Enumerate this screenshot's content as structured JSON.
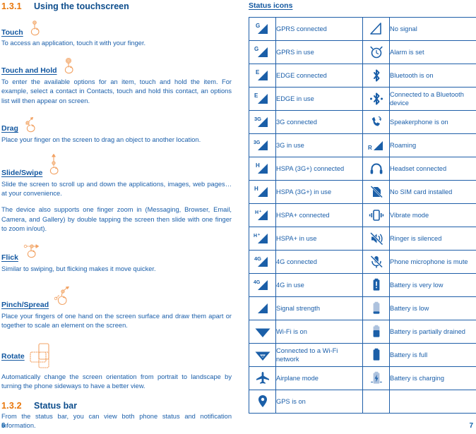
{
  "left_column": {
    "section": {
      "number": "1.3.1",
      "title": "Using the touchscreen"
    },
    "gestures": [
      {
        "name": "Touch",
        "icon": "hand-touch-icon",
        "paragraphs": [
          "To access an application, touch it with your finger."
        ]
      },
      {
        "name": "Touch and Hold",
        "icon": "hand-touch-hold-icon",
        "paragraphs": [
          "To enter the available options for an item, touch and hold the item. For example, select a contact in Contacts, touch and hold this contact, an options list will then appear on screen."
        ]
      },
      {
        "name": "Drag",
        "icon": "hand-drag-icon",
        "paragraphs": [
          "Place your finger on the screen to drag an object to another location."
        ]
      },
      {
        "name": "Slide/Swipe",
        "icon": "hand-slide-swipe-icon",
        "paragraphs": [
          "Slide the screen to scroll up and down the applications, images, web pages… at your convenience.",
          "The device also supports one finger zoom in (Messaging, Browser, Email, Camera, and Gallery) by double tapping the screen then slide with one finger to zoom in/out)."
        ]
      },
      {
        "name": "Flick",
        "icon": "hand-flick-icon",
        "paragraphs": [
          "Similar to swiping, but flicking makes it move quicker."
        ]
      },
      {
        "name": "Pinch/Spread",
        "icon": "hand-pinch-spread-icon",
        "paragraphs": [
          "Place your fingers of one hand on the screen surface and draw them apart or together to scale an element on the screen."
        ]
      },
      {
        "name": "Rotate",
        "icon": "rotate-device-icon",
        "paragraphs": [
          "Automatically change the screen orientation from portrait to landscape by turning the phone sideways to have a better view."
        ]
      }
    ],
    "section2": {
      "number": "1.3.2",
      "title": "Status bar"
    },
    "section2_paragraphs": [
      "From the status bar, you can view both phone status and notification information."
    ],
    "page_number": "6"
  },
  "right_column": {
    "table_heading": "Status icons",
    "rows": [
      {
        "left": {
          "icon": "gprs-connected-icon",
          "label": "GPRS connected"
        },
        "right": {
          "icon": "no-signal-icon",
          "label": "No signal"
        }
      },
      {
        "left": {
          "icon": "gprs-in-use-icon",
          "label": "GPRS in use"
        },
        "right": {
          "icon": "alarm-clock-icon",
          "label": "Alarm is set"
        }
      },
      {
        "left": {
          "icon": "edge-connected-icon",
          "label": "EDGE connected"
        },
        "right": {
          "icon": "bluetooth-icon",
          "label": "Bluetooth is on"
        }
      },
      {
        "left": {
          "icon": "edge-in-use-icon",
          "label": "EDGE in use"
        },
        "right": {
          "icon": "bluetooth-connected-icon",
          "label": "Connected to a Bluetooth device"
        }
      },
      {
        "left": {
          "icon": "3g-connected-icon",
          "label": "3G connected"
        },
        "right": {
          "icon": "speakerphone-icon",
          "label": "Speakerphone is on"
        }
      },
      {
        "left": {
          "icon": "3g-in-use-icon",
          "label": "3G in use"
        },
        "right": {
          "icon": "roaming-icon",
          "label": "Roaming"
        }
      },
      {
        "left": {
          "icon": "hspa-connected-icon",
          "label": "HSPA (3G+) connected"
        },
        "right": {
          "icon": "headset-icon",
          "label": "Headset connected"
        }
      },
      {
        "left": {
          "icon": "hspa-in-use-icon",
          "label": "HSPA (3G+) in use"
        },
        "right": {
          "icon": "no-sim-card-icon",
          "label": "No SIM card installed"
        }
      },
      {
        "left": {
          "icon": "hspaplus-connected-icon",
          "label": "HSPA+ connected"
        },
        "right": {
          "icon": "vibrate-mode-icon",
          "label": "Vibrate mode"
        }
      },
      {
        "left": {
          "icon": "hspaplus-in-use-icon",
          "label": "HSPA+ in use"
        },
        "right": {
          "icon": "ringer-silenced-icon",
          "label": "Ringer is silenced"
        }
      },
      {
        "left": {
          "icon": "4g-connected-icon",
          "label": "4G connected"
        },
        "right": {
          "icon": "microphone-mute-icon",
          "label": "Phone microphone is mute"
        }
      },
      {
        "left": {
          "icon": "4g-in-use-icon",
          "label": "4G in use"
        },
        "right": {
          "icon": "battery-very-low-icon",
          "label": "Battery is very low"
        }
      },
      {
        "left": {
          "icon": "signal-strength-icon",
          "label": "Signal strength"
        },
        "right": {
          "icon": "battery-low-icon",
          "label": "Battery is low"
        }
      },
      {
        "left": {
          "icon": "wifi-on-icon",
          "label": "Wi-Fi is on"
        },
        "right": {
          "icon": "battery-partial-icon",
          "label": "Battery is partially drained"
        }
      },
      {
        "left": {
          "icon": "wifi-connected-icon",
          "label": "Connected to a Wi-Fi network"
        },
        "right": {
          "icon": "battery-full-icon",
          "label": "Battery is full"
        }
      },
      {
        "left": {
          "icon": "airplane-mode-icon",
          "label": "Airplane mode"
        },
        "right": {
          "icon": "battery-charging-icon",
          "label": "Battery is charging"
        }
      },
      {
        "left": {
          "icon": "gps-on-icon",
          "label": "GPS is on"
        },
        "right": {
          "icon": "",
          "label": ""
        }
      }
    ],
    "page_number": "7"
  },
  "colors": {
    "accent_orange": "#e8760a",
    "heading_blue": "#0d4d8c",
    "body_blue": "#1b5faa",
    "icon_blue": "#1b5fa8",
    "gesture_orange": "#f2a365",
    "table_border": "#1e5ea8"
  }
}
